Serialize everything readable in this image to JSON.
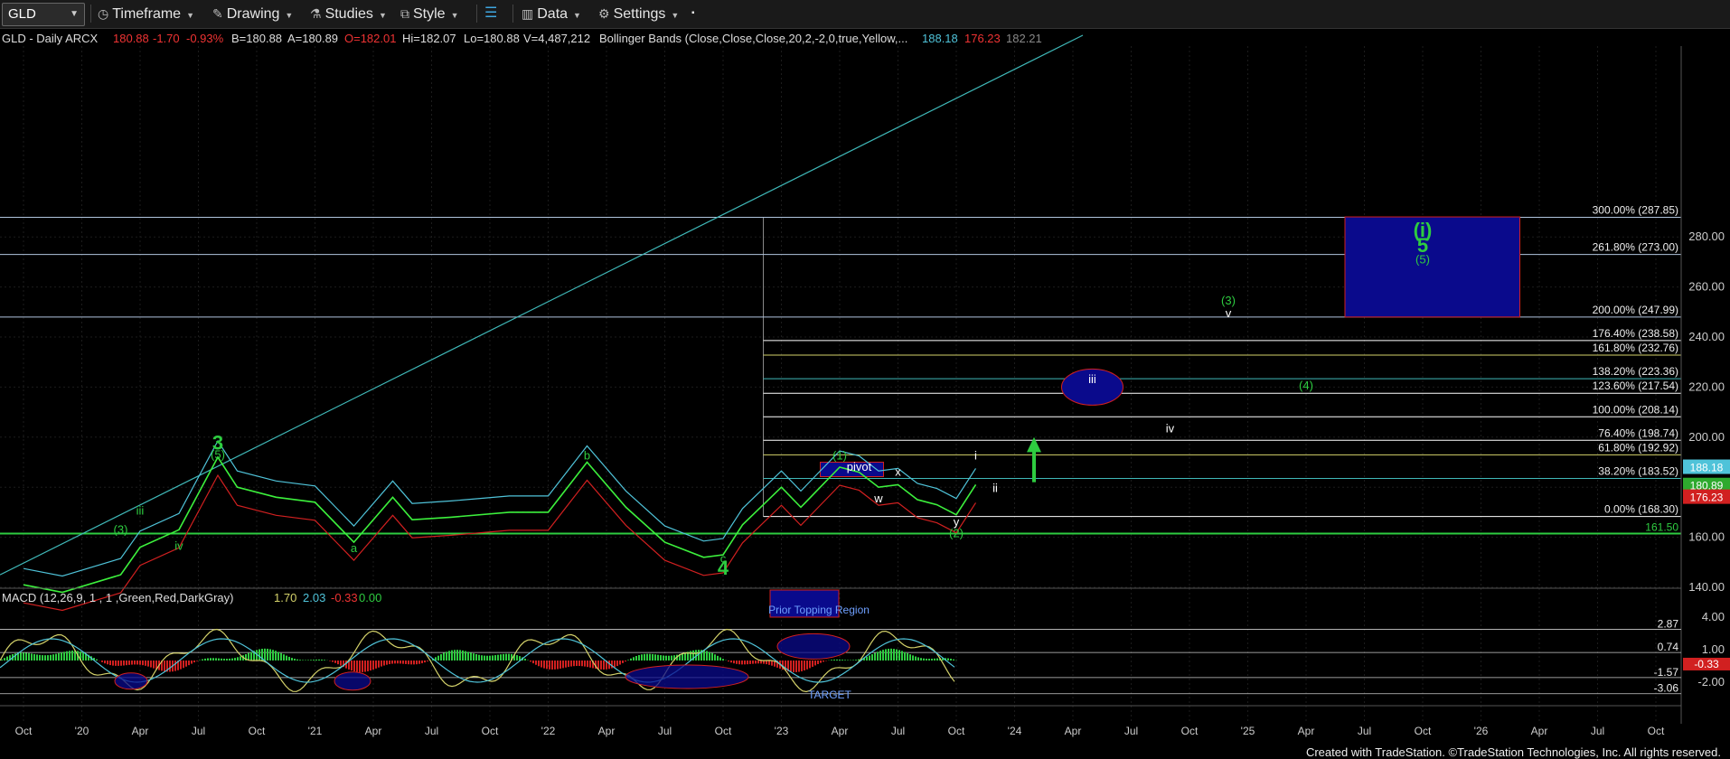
{
  "toolbar": {
    "symbol": "GLD",
    "timeframe": "Timeframe",
    "drawing": "Drawing",
    "studies": "Studies",
    "style": "Style",
    "data": "Data",
    "settings": "Settings"
  },
  "header": {
    "title": "GLD - Daily  ARCX",
    "last": "180.88",
    "chg": "-1.70",
    "pct": "-0.93%",
    "bid": "B=180.88",
    "ask": "A=180.89",
    "open": "O=182.01",
    "hi": "Hi=182.07",
    "lo": "Lo=180.88",
    "vol": "V=4,487,212",
    "bb_label": "Bollinger Bands (Close,Close,Close,20,2,-2,0,true,Yellow,...",
    "bb_vals": [
      "188.18",
      "176.23",
      "182.21"
    ]
  },
  "macd_header": {
    "label": "MACD (12,26,9, 1 , 1 ,Green,Red,DarkGray)",
    "vals": [
      "1.70",
      "2.03",
      "-0.33",
      "0.00"
    ]
  },
  "chart_data": {
    "type": "line",
    "y_ticks": [
      "280.00",
      "260.00",
      "240.00",
      "220.00",
      "200.00",
      "180.00",
      "160.00",
      "140.00"
    ],
    "ylim": [
      132,
      290
    ],
    "x_ticks": [
      "Oct",
      "'20",
      "Apr",
      "Jul",
      "Oct",
      "'21",
      "Apr",
      "Jul",
      "Oct",
      "'22",
      "Apr",
      "Jul",
      "Oct",
      "'23",
      "Apr",
      "Jul",
      "Oct",
      "'24",
      "Apr",
      "Jul",
      "Oct",
      "'25",
      "Apr",
      "Jul",
      "Oct",
      "'26",
      "Apr",
      "Jul",
      "Oct"
    ],
    "price_series": {
      "name": "GLD",
      "x": [
        "2019-10",
        "2019-12",
        "2020-03",
        "2020-04",
        "2020-06",
        "2020-08",
        "2020-09",
        "2020-11",
        "2021-01",
        "2021-03",
        "2021-05",
        "2021-06",
        "2021-08",
        "2021-11",
        "2022-01",
        "2022-03",
        "2022-05",
        "2022-07",
        "2022-09",
        "2022-10",
        "2022-11",
        "2023-01",
        "2023-02",
        "2023-04",
        "2023-05",
        "2023-06",
        "2023-07",
        "2023-08",
        "2023-09",
        "2023-10",
        "2023-11"
      ],
      "y": [
        141,
        138,
        145,
        156,
        163,
        192,
        180,
        176,
        174,
        158,
        176,
        167,
        168,
        170,
        170,
        190,
        172,
        158,
        152,
        153,
        165,
        180,
        172,
        188,
        186,
        180,
        181,
        175,
        173,
        169,
        181
      ]
    },
    "fib_levels": [
      {
        "label": "300.00% (287.85)",
        "value": 287.85,
        "color": "#b0c4de"
      },
      {
        "label": "261.80% (273.00)",
        "value": 273.0,
        "color": "#b0c4de"
      },
      {
        "label": "200.00% (247.99)",
        "value": 247.99,
        "color": "#b0c4de"
      },
      {
        "label": "176.40% (238.58)",
        "value": 238.58,
        "color": "#ffffff"
      },
      {
        "label": "161.80% (232.76)",
        "value": 232.76,
        "color": "#d4d26a"
      },
      {
        "label": "138.20% (223.36)",
        "value": 223.36,
        "color": "#3fb8b8"
      },
      {
        "label": "123.60% (217.54)",
        "value": 217.54,
        "color": "#ffffff"
      },
      {
        "label": "100.00% (208.14)",
        "value": 208.14,
        "color": "#ffffff"
      },
      {
        "label": "76.40% (198.74)",
        "value": 198.74,
        "color": "#ffffff"
      },
      {
        "label": "61.80% (192.92)",
        "value": 192.92,
        "color": "#d4d26a"
      },
      {
        "label": "38.20% (183.52)",
        "value": 183.52,
        "color": "#3fb8b8"
      },
      {
        "label": "0.00% (168.30)",
        "value": 168.3,
        "color": "#ffffff"
      }
    ],
    "support_line": {
      "label": "161.50",
      "value": 161.5
    },
    "price_tags": [
      {
        "label": "188.18",
        "value": 188.18,
        "color": "#4fc3d9"
      },
      {
        "label": "180.89",
        "value": 180.89,
        "color": "#2eaa2e"
      },
      {
        "label": "176.23",
        "value": 176.23,
        "color": "#d12020"
      }
    ],
    "wave_labels": [
      {
        "text": "3",
        "x": "2020-08",
        "y": 195,
        "color": "#2ecc40",
        "big": true
      },
      {
        "text": "(5)",
        "x": "2020-08",
        "y": 191.5,
        "color": "#2ecc40"
      },
      {
        "text": "b",
        "x": "2022-03",
        "y": 191,
        "color": "#2ecc40"
      },
      {
        "text": "(3)",
        "x": "2020-03",
        "y": 161.5,
        "color": "#2ecc40"
      },
      {
        "text": "iii",
        "x": "2020-04",
        "y": 169,
        "color": "#2ecc40"
      },
      {
        "text": "iv",
        "x": "2020-06",
        "y": 155,
        "color": "#2ecc40"
      },
      {
        "text": "a",
        "x": "2021-03",
        "y": 154,
        "color": "#2ecc40"
      },
      {
        "text": "c",
        "x": "2022-10",
        "y": 150,
        "color": "#2ecc40"
      },
      {
        "text": "4",
        "x": "2022-10",
        "y": 145,
        "color": "#2ecc40",
        "big": true
      },
      {
        "text": "(1)",
        "x": "2023-04",
        "y": 191,
        "color": "#2ecc40"
      },
      {
        "text": "pivot",
        "x": "2023-05",
        "y": 186.5,
        "color": "#ffffff"
      },
      {
        "text": "x",
        "x": "2023-07",
        "y": 184.5,
        "color": "#ffffff"
      },
      {
        "text": "w",
        "x": "2023-06",
        "y": 174,
        "color": "#ffffff"
      },
      {
        "text": "y",
        "x": "2023-10",
        "y": 164.5,
        "color": "#ffffff"
      },
      {
        "text": "(2)",
        "x": "2023-10",
        "y": 160,
        "color": "#2ecc40"
      },
      {
        "text": "i",
        "x": "2023-11",
        "y": 191,
        "color": "#ffffff"
      },
      {
        "text": "ii",
        "x": "2023-12",
        "y": 178,
        "color": "#ffffff"
      },
      {
        "text": "iii",
        "x": "2024-05",
        "y": 221.5,
        "color": "#ffffff"
      },
      {
        "text": "iv",
        "x": "2024-09",
        "y": 202,
        "color": "#ffffff"
      },
      {
        "text": "(3)",
        "x": "2024-12",
        "y": 253,
        "color": "#2ecc40"
      },
      {
        "text": "v",
        "x": "2024-12",
        "y": 248,
        "color": "#ffffff"
      },
      {
        "text": "(4)",
        "x": "2025-04",
        "y": 219,
        "color": "#2ecc40"
      },
      {
        "text": "(i)",
        "x": "2025-10",
        "y": 280,
        "color": "#2ecc40",
        "big": true
      },
      {
        "text": "5",
        "x": "2025-10",
        "y": 274,
        "color": "#2ecc40",
        "big": true
      },
      {
        "text": "(5)",
        "x": "2025-10",
        "y": 269.5,
        "color": "#2ecc40"
      }
    ],
    "target_box": {
      "x0": "2025-06",
      "x1": "2026-03",
      "y0": 248,
      "y1": 288
    }
  },
  "macd_data": {
    "y_ticks": [
      "4.00",
      "1.00",
      "-2.00"
    ],
    "levels": [
      {
        "label": "2.87",
        "value": 2.87
      },
      {
        "label": "0.74",
        "value": 0.74
      },
      {
        "label": "-1.57",
        "value": -1.57
      },
      {
        "label": "-3.06",
        "value": -3.06
      }
    ],
    "current_tag": "-0.33",
    "annotations": {
      "prior_topping": "Prior Topping Region",
      "target": "TARGET"
    }
  },
  "footer": "Created with TradeStation. ©TradeStation Technologies, Inc. All rights reserved."
}
